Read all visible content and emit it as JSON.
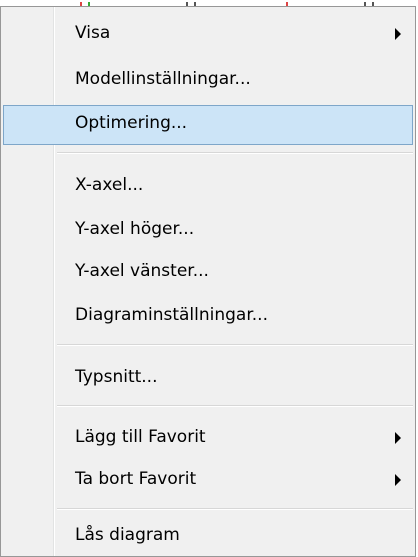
{
  "menu": {
    "items": [
      {
        "label": "Visa",
        "has_submenu": true
      },
      {
        "label": "Modellinställningar...",
        "has_submenu": false
      },
      {
        "label": "Optimering...",
        "has_submenu": false,
        "highlighted": true
      },
      {
        "label": "X-axel...",
        "has_submenu": false
      },
      {
        "label": "Y-axel höger...",
        "has_submenu": false
      },
      {
        "label": "Y-axel vänster...",
        "has_submenu": false
      },
      {
        "label": "Diagraminställningar...",
        "has_submenu": false
      },
      {
        "label": "Typsnitt...",
        "has_submenu": false
      },
      {
        "label": "Lägg till Favorit",
        "has_submenu": true
      },
      {
        "label": "Ta bort Favorit",
        "has_submenu": true
      },
      {
        "label": "Lås diagram",
        "has_submenu": false
      }
    ]
  },
  "colors": {
    "menu_background": "#f0f0f0",
    "highlight_background": "#cce4f7",
    "highlight_border": "#7ea6c9",
    "text": "#000000"
  },
  "icons": {
    "submenu_arrow": "chevron-right-icon"
  }
}
